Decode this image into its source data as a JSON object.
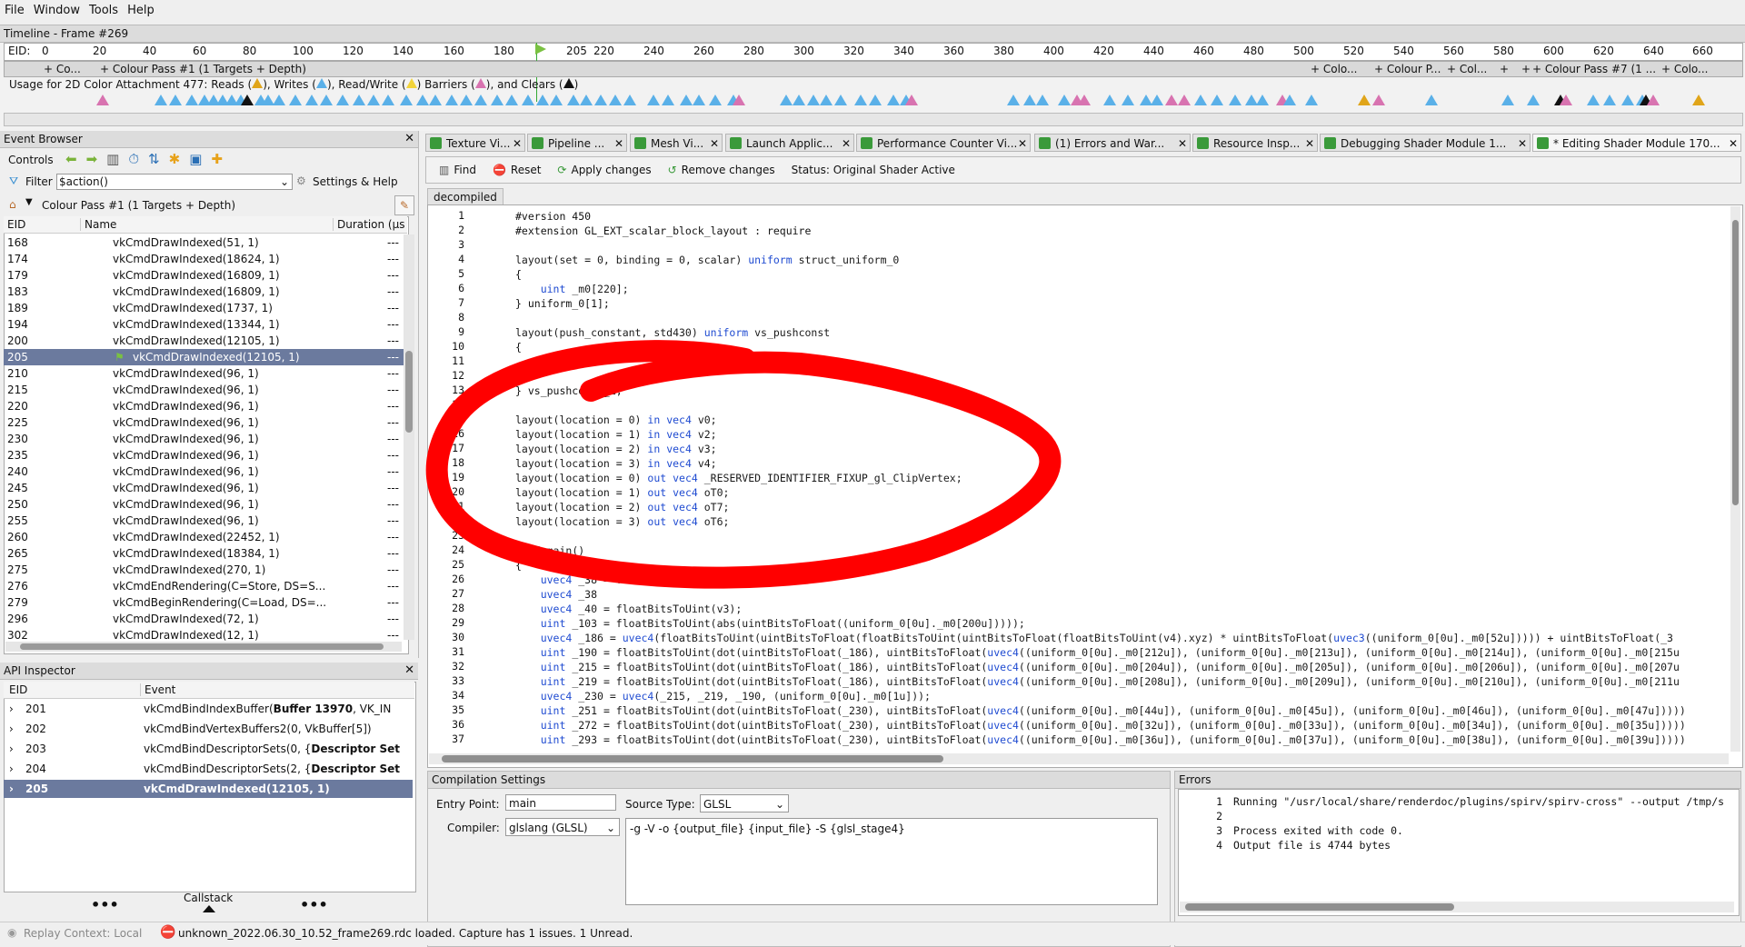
{
  "menu": [
    "File",
    "Window",
    "Tools",
    "Help"
  ],
  "timeline": {
    "title": "Timeline - Frame #269",
    "eid_label": "EID:",
    "ticks": [
      "0",
      "20",
      "40",
      "60",
      "80",
      "100",
      "120",
      "140",
      "160",
      "180",
      "205",
      "220",
      "240",
      "260",
      "280",
      "300",
      "320",
      "340",
      "360",
      "380",
      "400",
      "420",
      "440",
      "460",
      "480",
      "500",
      "520",
      "540",
      "560",
      "580",
      "600",
      "620",
      "640",
      "660"
    ],
    "passes": [
      "+ Co...",
      "+ Colour Pass #1 (1 Targets + Depth)",
      "+ Colo...",
      "+ Colour P...",
      "+ Col...",
      "+",
      "+",
      "+ Colour Pass #7 (1 ...",
      "+ Colo..."
    ],
    "usage": {
      "prefix": "Usage for 2D Color Attachment 477: Reads (",
      "writes": "), Writes (",
      "rw": "), Read/Write (",
      "barriers": ") Barriers (",
      "clears": "), and Clears (",
      "suffix": ")"
    }
  },
  "event_browser": {
    "title": "Event Browser",
    "controls_label": "Controls",
    "filter_label": "Filter",
    "filter_value": "$action()",
    "settings_label": "Settings & Help",
    "breadcrumb": "Colour Pass #1 (1 Targets + Depth)",
    "columns": [
      "EID",
      "Name",
      "Duration (µs"
    ],
    "rows": [
      {
        "eid": "168",
        "name": "vkCmdDrawIndexed(51, 1)",
        "dur": "---"
      },
      {
        "eid": "174",
        "name": "vkCmdDrawIndexed(18624, 1)",
        "dur": "---"
      },
      {
        "eid": "179",
        "name": "vkCmdDrawIndexed(16809, 1)",
        "dur": "---"
      },
      {
        "eid": "183",
        "name": "vkCmdDrawIndexed(16809, 1)",
        "dur": "---"
      },
      {
        "eid": "189",
        "name": "vkCmdDrawIndexed(1737, 1)",
        "dur": "---"
      },
      {
        "eid": "194",
        "name": "vkCmdDrawIndexed(13344, 1)",
        "dur": "---"
      },
      {
        "eid": "200",
        "name": "vkCmdDrawIndexed(12105, 1)",
        "dur": "---"
      },
      {
        "eid": "205",
        "name": "vkCmdDrawIndexed(12105, 1)",
        "dur": "---"
      },
      {
        "eid": "210",
        "name": "vkCmdDrawIndexed(96, 1)",
        "dur": "---"
      },
      {
        "eid": "215",
        "name": "vkCmdDrawIndexed(96, 1)",
        "dur": "---"
      },
      {
        "eid": "220",
        "name": "vkCmdDrawIndexed(96, 1)",
        "dur": "---"
      },
      {
        "eid": "225",
        "name": "vkCmdDrawIndexed(96, 1)",
        "dur": "---"
      },
      {
        "eid": "230",
        "name": "vkCmdDrawIndexed(96, 1)",
        "dur": "---"
      },
      {
        "eid": "235",
        "name": "vkCmdDrawIndexed(96, 1)",
        "dur": "---"
      },
      {
        "eid": "240",
        "name": "vkCmdDrawIndexed(96, 1)",
        "dur": "---"
      },
      {
        "eid": "245",
        "name": "vkCmdDrawIndexed(96, 1)",
        "dur": "---"
      },
      {
        "eid": "250",
        "name": "vkCmdDrawIndexed(96, 1)",
        "dur": "---"
      },
      {
        "eid": "255",
        "name": "vkCmdDrawIndexed(96, 1)",
        "dur": "---"
      },
      {
        "eid": "260",
        "name": "vkCmdDrawIndexed(22452, 1)",
        "dur": "---"
      },
      {
        "eid": "265",
        "name": "vkCmdDrawIndexed(18384, 1)",
        "dur": "---"
      },
      {
        "eid": "275",
        "name": "vkCmdDrawIndexed(270, 1)",
        "dur": "---"
      },
      {
        "eid": "276",
        "name": "vkCmdEndRendering(C=Store, DS=S...",
        "dur": "---"
      },
      {
        "eid": "279",
        "name": "vkCmdBeginRendering(C=Load, DS=...",
        "dur": "---"
      },
      {
        "eid": "296",
        "name": "vkCmdDrawIndexed(72, 1)",
        "dur": "---"
      },
      {
        "eid": "302",
        "name": "vkCmdDrawIndexed(12, 1)",
        "dur": "---"
      }
    ]
  },
  "api_inspector": {
    "title": "API Inspector",
    "columns": [
      "EID",
      "Event"
    ],
    "rows": [
      {
        "eid": "201",
        "event": "vkCmdBindIndexBuffer(",
        "bold": "Buffer 13970",
        "rest": ", VK_IN"
      },
      {
        "eid": "202",
        "event": "vkCmdBindVertexBuffers2(0, VkBuffer[5])",
        "bold": "",
        "rest": ""
      },
      {
        "eid": "203",
        "event": "vkCmdBindDescriptorSets(0, {",
        "bold": "Descriptor Set",
        "rest": ""
      },
      {
        "eid": "204",
        "event": "vkCmdBindDescriptorSets(2, {",
        "bold": "Descriptor Set",
        "rest": ""
      },
      {
        "eid": "205",
        "event": "vkCmdDrawIndexed(12105, 1)",
        "bold": "",
        "rest": ""
      }
    ],
    "callstack_label": "Callstack"
  },
  "tabs": [
    "Texture Vi...",
    "Pipeline ...",
    "Mesh Vi...",
    "Launch Applic...",
    "Performance Counter Vi...",
    "(1) Errors and War...",
    "Resource Insp...",
    "Debugging Shader Module 1...",
    "* Editing Shader Module 170..."
  ],
  "shader_toolbar": {
    "find": "Find",
    "reset": "Reset",
    "apply": "Apply changes",
    "remove": "Remove changes",
    "status": "Status: Original Shader Active"
  },
  "editor": {
    "tab_label": "decompiled",
    "lines": [
      {
        "n": "1",
        "t": "#version 450"
      },
      {
        "n": "2",
        "t": "#extension GL_EXT_scalar_block_layout : require"
      },
      {
        "n": "3",
        "t": ""
      },
      {
        "n": "4",
        "t": "layout(set = 0, binding = 0, scalar) uniform struct_uniform_0"
      },
      {
        "n": "5",
        "t": "{"
      },
      {
        "n": "6",
        "t": "    uint _m0[220];"
      },
      {
        "n": "7",
        "t": "} uniform_0[1];"
      },
      {
        "n": "8",
        "t": ""
      },
      {
        "n": "9",
        "t": "layout(push_constant, std430) uniform vs_pushconst"
      },
      {
        "n": "10",
        "t": "{"
      },
      {
        "n": "11",
        "t": ""
      },
      {
        "n": "12",
        "t": ""
      },
      {
        "n": "13",
        "t": "} vs_pushconst_1;"
      },
      {
        "n": "14",
        "t": ""
      },
      {
        "n": "15",
        "t": "layout(location = 0) in vec4 v0;"
      },
      {
        "n": "16",
        "t": "layout(location = 1) in vec4 v2;"
      },
      {
        "n": "17",
        "t": "layout(location = 2) in vec4 v3;"
      },
      {
        "n": "18",
        "t": "layout(location = 3) in vec4 v4;"
      },
      {
        "n": "19",
        "t": "layout(location = 0) out vec4 _RESERVED_IDENTIFIER_FIXUP_gl_ClipVertex;"
      },
      {
        "n": "20",
        "t": "layout(location = 1) out vec4 oT0;"
      },
      {
        "n": "21",
        "t": "layout(location = 2) out vec4 oT7;"
      },
      {
        "n": "22",
        "t": "layout(location = 3) out vec4 oT6;"
      },
      {
        "n": "23",
        "t": ""
      },
      {
        "n": "24",
        "t": "void main()"
      },
      {
        "n": "25",
        "t": "{"
      },
      {
        "n": "26",
        "t": "    uvec4 _38 = floatBitsToUint(v0);"
      },
      {
        "n": "27",
        "t": "    uvec4 _38"
      },
      {
        "n": "28",
        "t": "    uvec4 _40 = floatBitsToUint(v3);"
      },
      {
        "n": "29",
        "t": "    uint _103 = floatBitsToUint(abs(uintBitsToFloat((uniform_0[0u]._m0[200u]))));"
      },
      {
        "n": "30",
        "t": "    uvec4 _186 = uvec4(floatBitsToUint(uintBitsToFloat(floatBitsToUint(uintBitsToFloat(floatBitsToUint(v4).xyz) * uintBitsToFloat(uvec3((uniform_0[0u]._m0[52u])))) + uintBitsToFloat(_3"
      },
      {
        "n": "31",
        "t": "    uint _190 = floatBitsToUint(dot(uintBitsToFloat(_186), uintBitsToFloat(uvec4((uniform_0[0u]._m0[212u]), (uniform_0[0u]._m0[213u]), (uniform_0[0u]._m0[214u]), (uniform_0[0u]._m0[215u"
      },
      {
        "n": "32",
        "t": "    uint _215 = floatBitsToUint(dot(uintBitsToFloat(_186), uintBitsToFloat(uvec4((uniform_0[0u]._m0[204u]), (uniform_0[0u]._m0[205u]), (uniform_0[0u]._m0[206u]), (uniform_0[0u]._m0[207u"
      },
      {
        "n": "33",
        "t": "    uint _219 = floatBitsToUint(dot(uintBitsToFloat(_186), uintBitsToFloat(uvec4((uniform_0[0u]._m0[208u]), (uniform_0[0u]._m0[209u]), (uniform_0[0u]._m0[210u]), (uniform_0[0u]._m0[211u"
      },
      {
        "n": "34",
        "t": "    uvec4 _230 = uvec4(_215, _219, _190, (uniform_0[0u]._m0[1u]));"
      },
      {
        "n": "35",
        "t": "    uint _251 = floatBitsToUint(dot(uintBitsToFloat(_230), uintBitsToFloat(uvec4((uniform_0[0u]._m0[44u]), (uniform_0[0u]._m0[45u]), (uniform_0[0u]._m0[46u]), (uniform_0[0u]._m0[47u]))))"
      },
      {
        "n": "36",
        "t": "    uint _272 = floatBitsToUint(dot(uintBitsToFloat(_230), uintBitsToFloat(uvec4((uniform_0[0u]._m0[32u]), (uniform_0[0u]._m0[33u]), (uniform_0[0u]._m0[34u]), (uniform_0[0u]._m0[35u]))))"
      },
      {
        "n": "37",
        "t": "    uint _293 = floatBitsToUint(dot(uintBitsToFloat(_230), uintBitsToFloat(uvec4((uniform_0[0u]._m0[36u]), (uniform_0[0u]._m0[37u]), (uniform_0[0u]._m0[38u]), (uniform_0[0u]._m0[39u]))))"
      }
    ]
  },
  "compilation": {
    "title": "Compilation Settings",
    "entry_label": "Entry Point:",
    "entry_value": "main",
    "source_type_label": "Source Type:",
    "source_type_value": "GLSL",
    "compiler_label": "Compiler:",
    "compiler_value": "glslang (GLSL)",
    "args": "-g -V -o {output_file} {input_file} -S {glsl_stage4}"
  },
  "errors": {
    "title": "Errors",
    "lines": [
      {
        "n": "1",
        "t": "Running \"/usr/local/share/renderdoc/plugins/spirv/spirv-cross\" --output /tmp/s"
      },
      {
        "n": "2",
        "t": ""
      },
      {
        "n": "3",
        "t": "Process exited with code 0."
      },
      {
        "n": "4",
        "t": "Output file is 4744 bytes"
      }
    ]
  },
  "statusbar": {
    "replay": "Replay Context: Local",
    "message": "unknown_2022.06.30_10.52_frame269.rdc loaded. Capture has 1 issues. 1 Unread."
  },
  "colors": {
    "selection": "#6b7a9e",
    "keyword": "#1f4bd1",
    "annotation": "#ff0000",
    "reads": "#5ab0e8",
    "writes": "#d873b0"
  }
}
